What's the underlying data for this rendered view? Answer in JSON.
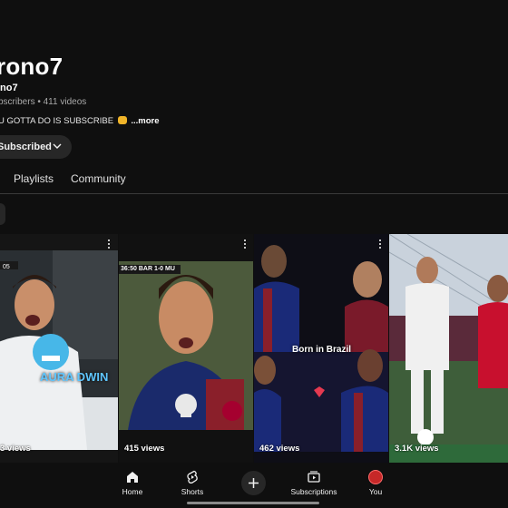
{
  "channel": {
    "name": "rono7",
    "handle": "no7",
    "stats": "bscribers • 411 videos",
    "description": "U GOTTA DO IS SUBSCRIBE",
    "more_label": "...more",
    "subscribed_label": "Subscribed"
  },
  "tabs": [
    {
      "label": "Playlists"
    },
    {
      "label": "Community"
    }
  ],
  "shorts": [
    {
      "views": "3 views",
      "overlay": "AURA DWIN"
    },
    {
      "views": "415 views",
      "overlay": "36:50 BAR 1-0 MU"
    },
    {
      "views": "462 views",
      "overlay": "Born in Brazil"
    },
    {
      "views": "3.1K views",
      "overlay": ""
    }
  ],
  "bottom_nav": {
    "home": "Home",
    "shorts": "Shorts",
    "subscriptions": "Subscriptions",
    "you": "You"
  },
  "colors": {
    "background": "#0f0f0f",
    "button_bg": "#272727",
    "muted_text": "#aaaaaa",
    "accent_red": "#c62828"
  }
}
